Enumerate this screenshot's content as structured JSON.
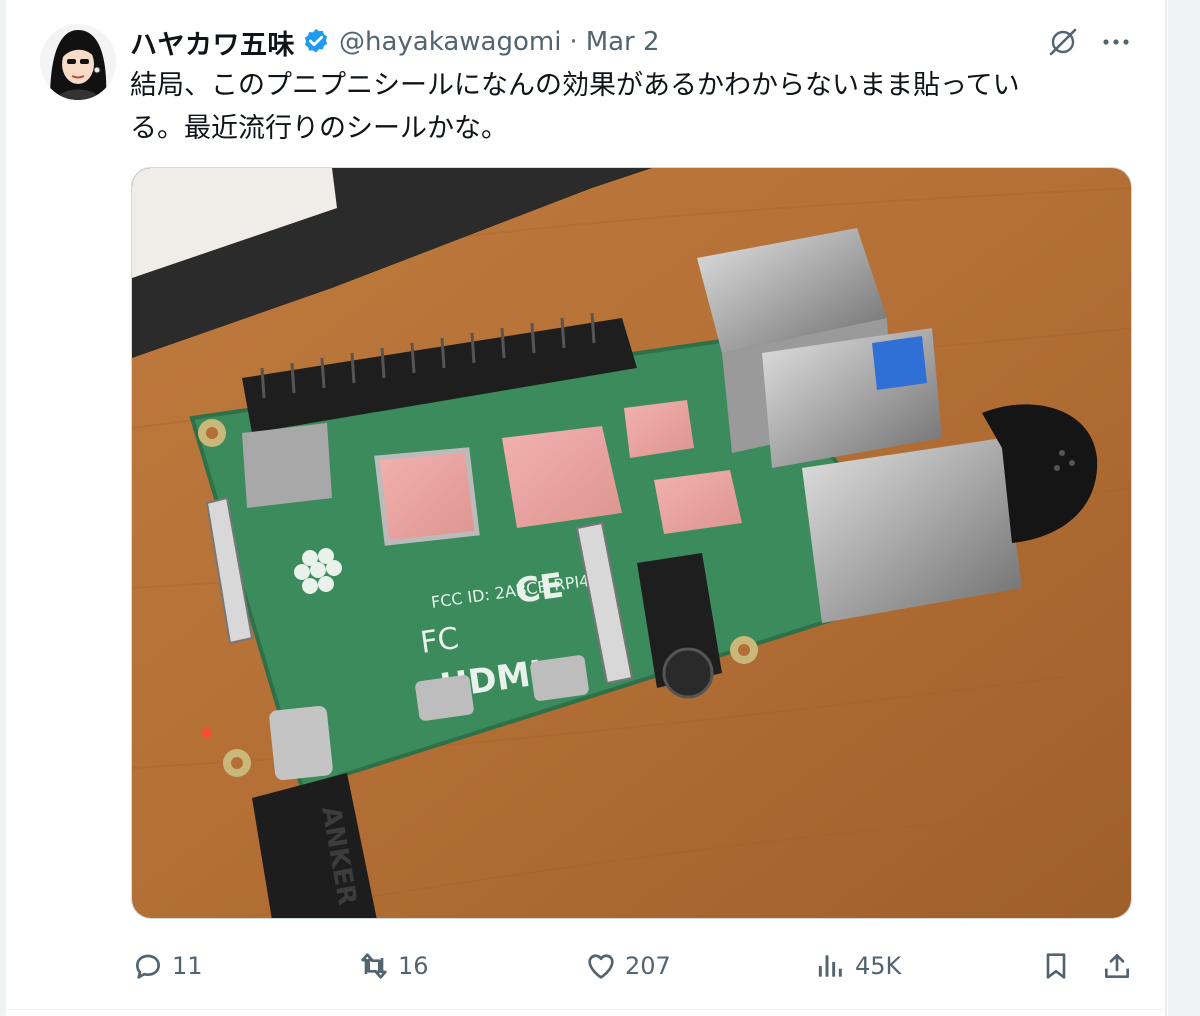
{
  "tweet": {
    "author_name": "ハヤカワ五味",
    "handle": "@hayakawagomi",
    "separator": "·",
    "date": "Mar 2",
    "text_lines": [
      "結局、このプニプニシールになんの効果があるかわからないまま貼ってい",
      "る。最近流行りのシールかな。"
    ]
  },
  "media": {
    "description_icons": [
      "raspberry-pi-board-photo"
    ],
    "cable_brand": "ANKER"
  },
  "actions": {
    "reply_count": "11",
    "retweet_count": "16",
    "like_count": "207",
    "views_count": "45K"
  },
  "icons": {
    "verified": "verified-badge-icon",
    "grok": "grok-icon",
    "more": "more-icon",
    "reply": "reply-icon",
    "retweet": "retweet-icon",
    "like": "heart-icon",
    "views": "views-icon",
    "bookmark": "bookmark-icon",
    "share": "share-icon"
  },
  "colors": {
    "text": "#0f1419",
    "muted": "#536471",
    "verified": "#1d9bf0",
    "border": "#cfd9de"
  }
}
